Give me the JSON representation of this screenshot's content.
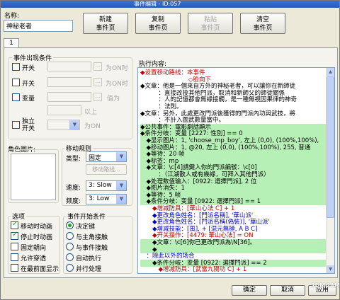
{
  "window": {
    "title": "事件编辑 - ID:057"
  },
  "name": {
    "label": "名称:",
    "value": "神秘老者"
  },
  "toolbar": {
    "new": "新建\n事件页",
    "copy": "复制\n事件页",
    "paste": "粘贴\n事件页",
    "clear": "清空\n事件页"
  },
  "tab": "1",
  "conditions": {
    "title": "事件出现条件",
    "switch1": "开关",
    "switch2": "开关",
    "variable": "变量",
    "value_label": "值为",
    "above": "以上",
    "self_switch": "独立\n开关",
    "on1": "为ON时",
    "on2": "为ON时",
    "on3": "为ON"
  },
  "image": {
    "title": "角色图片:"
  },
  "movement": {
    "title": "移动规则",
    "type_label": "类型:",
    "type_value": "固定",
    "route_button": "移动路线...",
    "speed_label": "速度:",
    "speed_value": "3: Slow",
    "freq_label": "频度:",
    "freq_value": "3: Low"
  },
  "options": {
    "title": "选项",
    "items": [
      "移动时动画",
      "停止时动画",
      "固定朝向",
      "允许穿透",
      "在最前面显示"
    ],
    "checked": [
      true,
      true,
      false,
      false,
      false
    ]
  },
  "trigger": {
    "title": "事件开始条件",
    "items": [
      "决定键",
      "与主角接触",
      "与事件接触",
      "自动执行",
      "并行处理"
    ],
    "selected": 0
  },
  "commands": {
    "title": "执行内容:",
    "lines": [
      {
        "t": "◆设置移动路线：本事件",
        "c": "red"
      },
      {
        "t": "　　　　　　　　◇脸向下",
        "c": "red"
      },
      {
        "t": "◆文章：他是一個來自方外的神秘老者，可以讓你在新師徒",
        "c": ""
      },
      {
        "t": "　　　：直接改投其他門派，取消和新師父的師徒關係",
        "c": ""
      },
      {
        "t": "　　　：人的記憶都會無緣接觸，是一種無視因果律的神奇",
        "c": ""
      },
      {
        "t": "　　　：法則。",
        "c": ""
      },
      {
        "t": "◆文章：另外，此處更改門派後獲得的門派內功與武技，將",
        "c": ""
      },
      {
        "t": "　　　：不計入圖武數量當中。",
        "c": ""
      },
      {
        "t": "◆公共事件：電影劇話顯示",
        "c": "hl"
      },
      {
        "t": "◆条件分岐：变量 [2227: 性別] == 0",
        "c": "hl"
      },
      {
        "t": "　◆显示图片：1, 'choose_mp_boy', 左上 (0,0), (100%,100%),",
        "c": "hl"
      },
      {
        "t": "　◆移动图片：1, @20, 左上 (0,0), (100%,100%), 255, 普通",
        "c": "hl"
      },
      {
        "t": "　◆等待：20 帧",
        "c": "hl"
      },
      {
        "t": "　◆标签：mp",
        "c": "hl"
      },
      {
        "t": "　◆文章：\\c[4]請鍵入你的門派編號：\\c[0]",
        "c": "hl"
      },
      {
        "t": "　　　：（江湖散人或有幾緣，可拜入其他門派）",
        "c": "hl"
      },
      {
        "t": "　◆处理数值输入：[0922: 選擇門派], 2 位",
        "c": "hl"
      },
      {
        "t": "　◆图片消失：1",
        "c": "hl"
      },
      {
        "t": "　◆等待：5 帧",
        "c": "hl"
      },
      {
        "t": "　◆条件分岐：变量 [0922: 選擇門派] == 1",
        "c": "hl"
      },
      {
        "t": "　　◆增减防具：[華山心法 C] + 1",
        "c": "red"
      },
      {
        "t": "　　◆更改角色姓名：[門派名稱], '華山派'",
        "c": "blue"
      },
      {
        "t": "　　◆更改角色姓名：[門派名稱(偽裝)], '華山派'",
        "c": "blue"
      },
      {
        "t": "　　◆增减技能：[風], + [混元無極, A B C]",
        "c": "blue"
      },
      {
        "t": "　　◆开关操作：[4479: 華山心法] = ON",
        "c": "red"
      },
      {
        "t": "　　◆文章：\\c[6]你已更改門派為\\N[36]。",
        "c": "hl"
      },
      {
        "t": "　　◆",
        "c": "hl"
      },
      {
        "t": "　：除此以外的场合",
        "c": "blue"
      },
      {
        "t": "　　◆条件分岐：变量 [0922: 選擇門派] == 2",
        "c": "hl"
      },
      {
        "t": "　　　◆增减防具：[武當九陽功 C] + 1",
        "c": "red"
      }
    ]
  },
  "footer": {
    "ok": "确定",
    "cancel": "取消",
    "apply": "应用"
  },
  "watermark": "3DMGAME"
}
